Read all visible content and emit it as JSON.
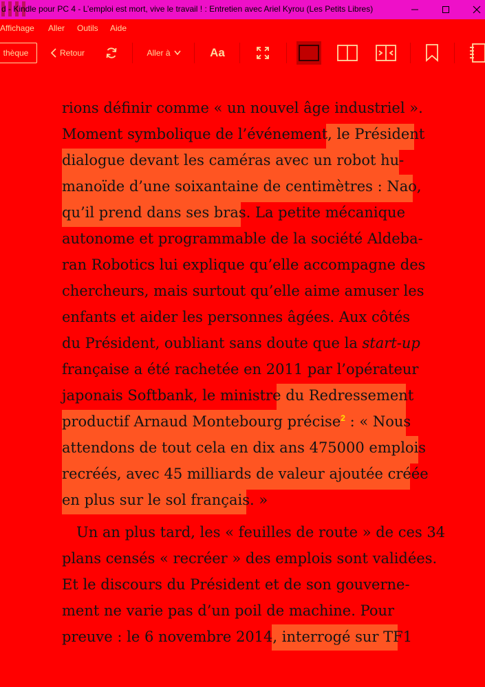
{
  "window": {
    "title": "d - Kindle pour PC 4 - L’emploi est mort, vive le travail ! : Entretien avec Ariel Kyrou (Les Petits Libres)"
  },
  "menu": {
    "items": [
      "Affichage",
      "Aller",
      "Outils",
      "Aide"
    ]
  },
  "toolbar": {
    "library_label": "thèque",
    "back_label": "Retour",
    "goto_label": "Aller à",
    "font_label": "Aa"
  },
  "book": {
    "lines": [
      {
        "segments": [
          {
            "text": "rions définir comme « un nouvel âge industriel »."
          }
        ]
      },
      {
        "segments": [
          {
            "text": "Moment symbolique de l’événement, "
          },
          {
            "text": "le Président",
            "highlight": true
          }
        ]
      },
      {
        "segments": [
          {
            "text": "dialogue devant les caméras avec un robot hu-",
            "highlight": true
          }
        ]
      },
      {
        "segments": [
          {
            "text": "manoïde d’une soixantaine de centimètres : Nao,",
            "highlight": true
          }
        ]
      },
      {
        "segments": [
          {
            "text": "qu’il prend dans ses bras.",
            "highlight": true
          },
          {
            "text": " La petite mécanique"
          }
        ]
      },
      {
        "segments": [
          {
            "text": "autonome et programmable de la société Aldeba-"
          }
        ]
      },
      {
        "segments": [
          {
            "text": "ran Robotics lui explique qu’elle accompagne des"
          }
        ]
      },
      {
        "segments": [
          {
            "text": "chercheurs, mais surtout qu’elle aime amuser les"
          }
        ]
      },
      {
        "segments": [
          {
            "text": "enfants et aider les personnes âgées. Aux côtés"
          }
        ]
      },
      {
        "segments": [
          {
            "text": "du Président, oubliant sans doute que la "
          },
          {
            "text": "start-up",
            "italic": true
          }
        ]
      },
      {
        "segments": [
          {
            "text": "française a été rachetée en 2011 par l’opérateur"
          }
        ]
      },
      {
        "segments": [
          {
            "text": "japonais Softbank, le ministre "
          },
          {
            "text": "du Redressement",
            "highlight": true
          }
        ]
      },
      {
        "segments": [
          {
            "text": "productif Arnaud Montebourg précise",
            "highlight": true
          },
          {
            "text": "2",
            "footnote": true,
            "highlight": true
          },
          {
            "text": " : « Nous",
            "highlight": true
          }
        ]
      },
      {
        "segments": [
          {
            "text": "attendons de tout cela en dix ans 475000 emplois",
            "highlight": true
          }
        ]
      },
      {
        "segments": [
          {
            "text": "recréés, avec 45 milliards de valeur ajoutée créée",
            "highlight": true
          }
        ]
      },
      {
        "segments": [
          {
            "text": "en plus sur le sol français.",
            "highlight": true
          },
          {
            "text": " »"
          }
        ]
      },
      {
        "segments": [
          {
            "text": "   Un an plus tard, les « feuilles de route » de ces 34"
          }
        ]
      },
      {
        "segments": [
          {
            "text": "plans censés « recréer » des emplois sont validées."
          }
        ]
      },
      {
        "segments": [
          {
            "text": "Et le discours du Président et de son gouverne-"
          }
        ]
      },
      {
        "segments": [
          {
            "text": "ment ne varie pas d’un poil de machine. Pour"
          }
        ]
      },
      {
        "segments": [
          {
            "text": "preuve : le 6 novembre 2014, "
          },
          {
            "text": "interrogé sur TF1",
            "highlight": true
          }
        ]
      }
    ]
  },
  "colors": {
    "background": "#ff0000",
    "highlight": "#ff5522",
    "titlebar": "#ee10c8",
    "chrome_text": "#ffd9a0"
  }
}
